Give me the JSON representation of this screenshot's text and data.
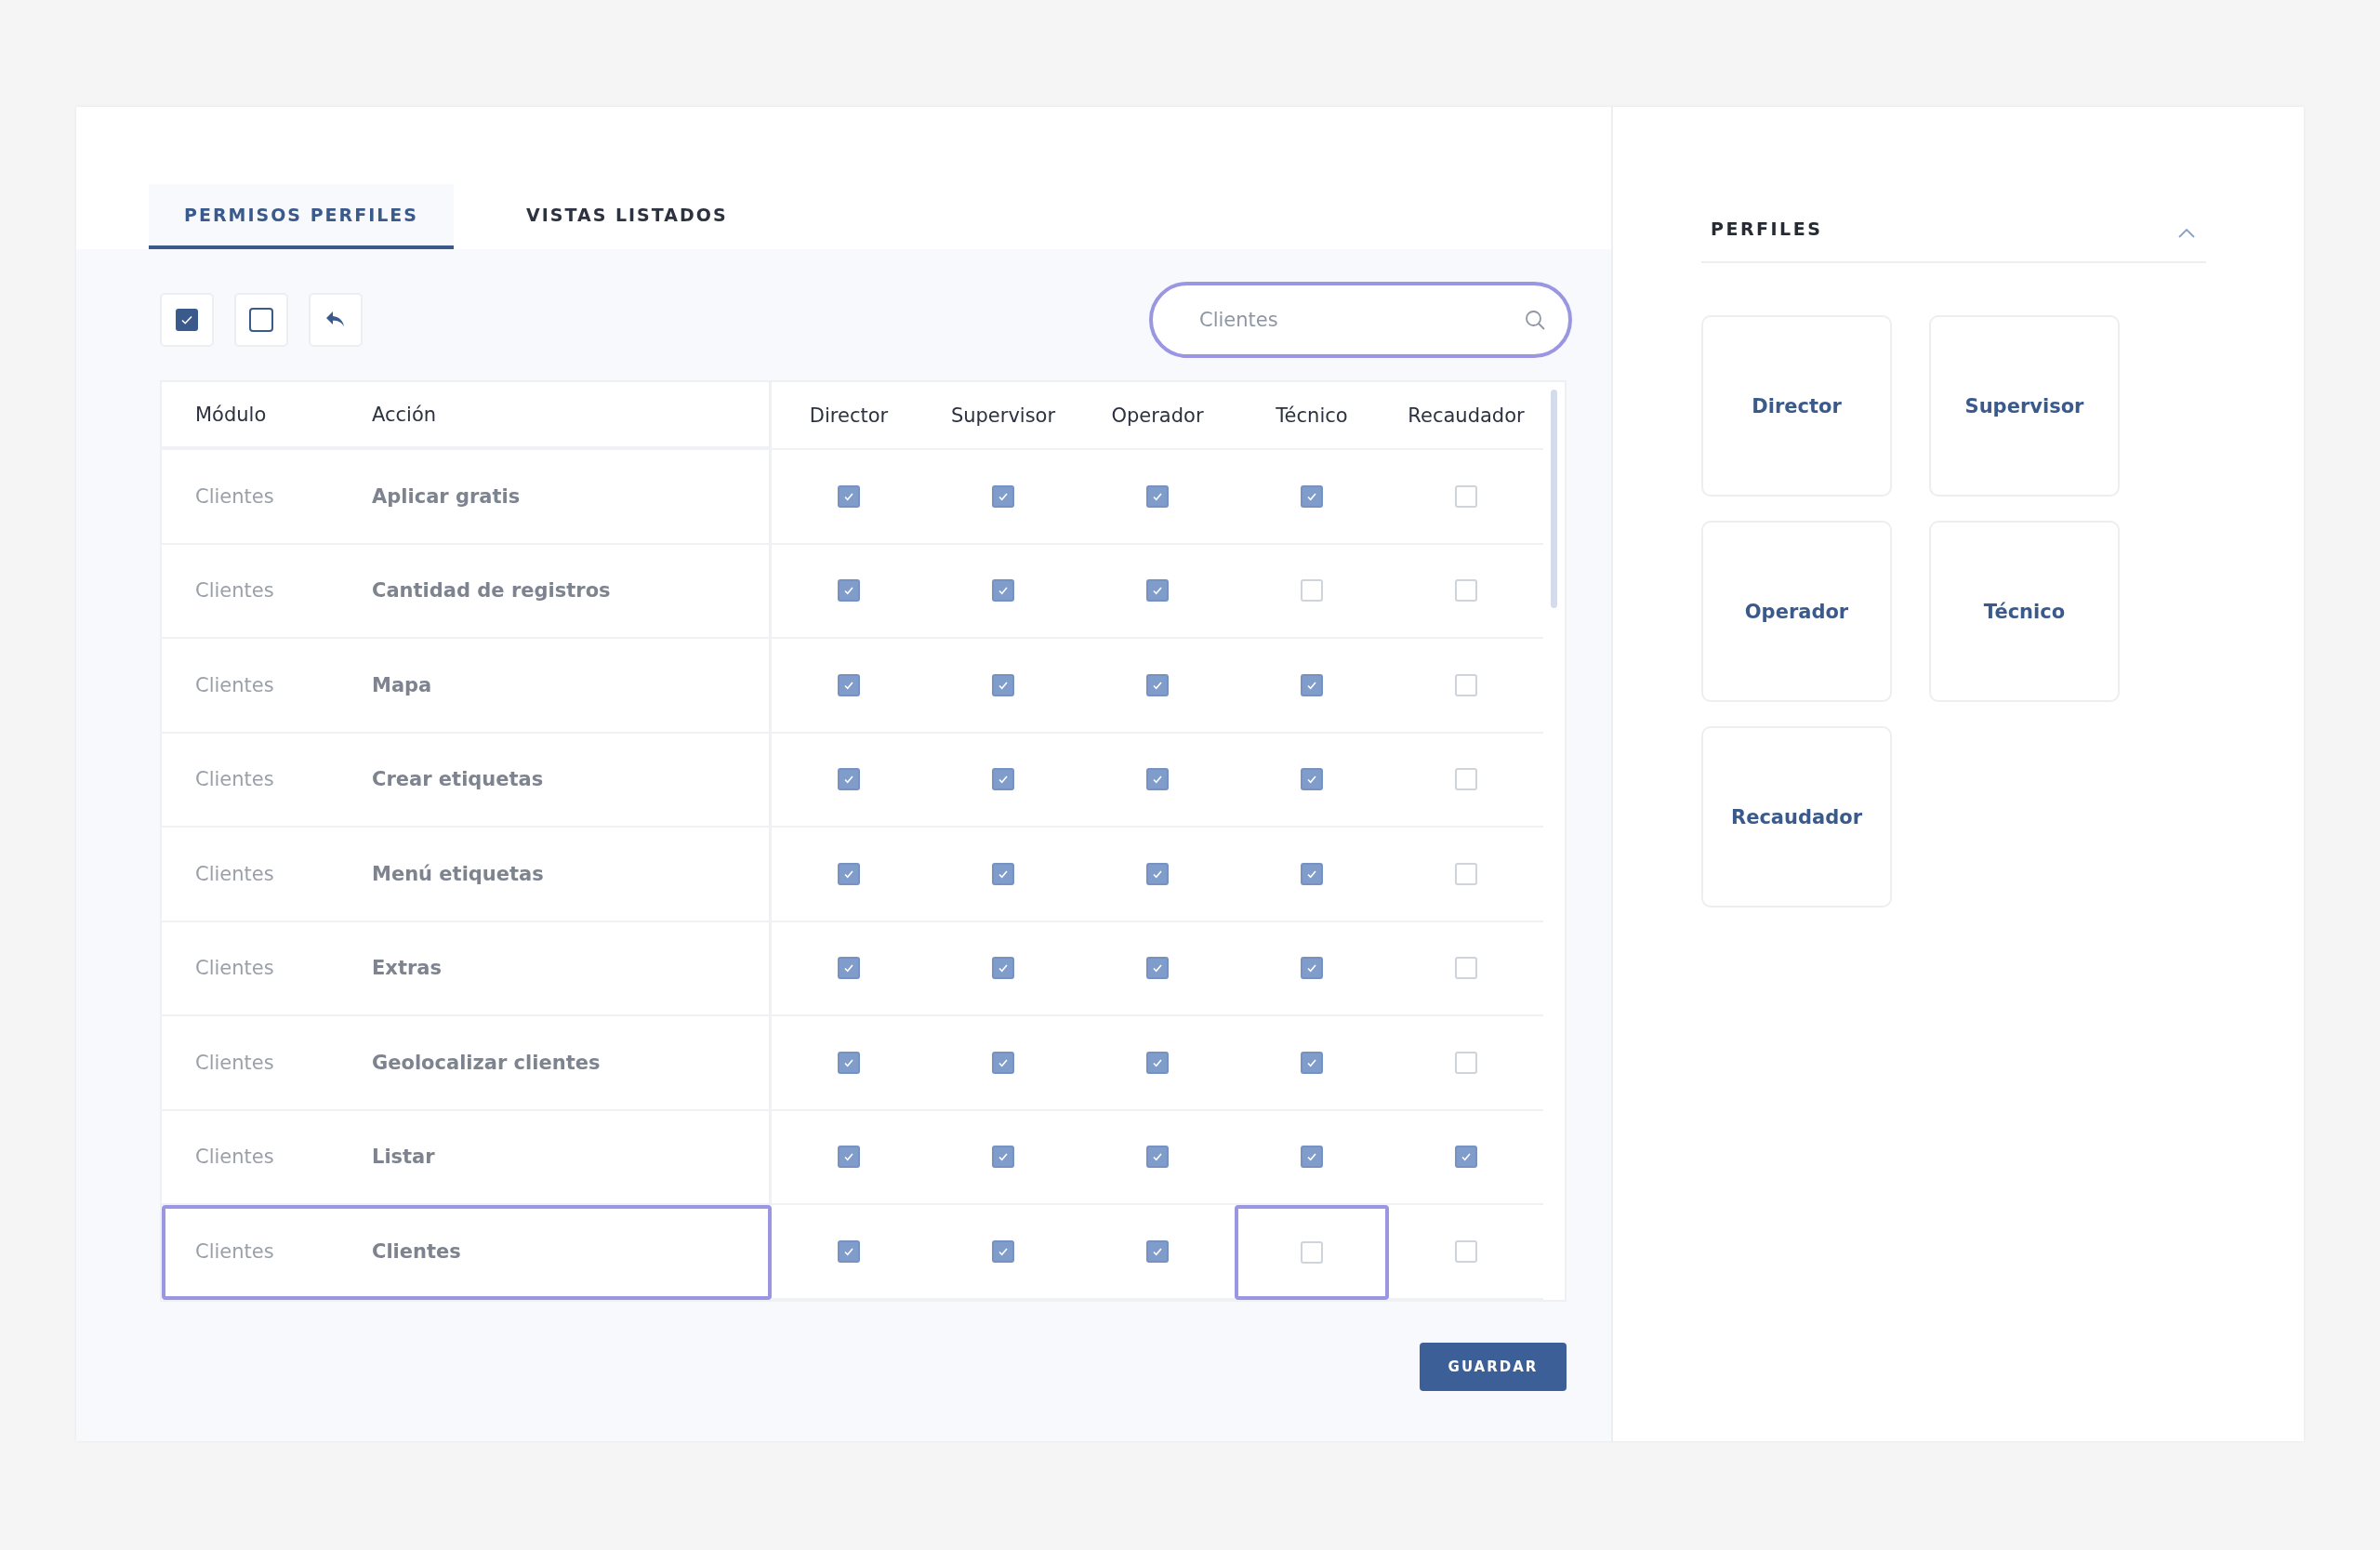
{
  "tabs": [
    {
      "label": "PERMISOS PERFILES",
      "selected": true
    },
    {
      "label": "VISTAS LISTADOS",
      "selected": false
    }
  ],
  "search": {
    "placeholder": "Clientes",
    "focused": true
  },
  "table": {
    "columns": [
      "Módulo",
      "Acción",
      "Director",
      "Supervisor",
      "Operador",
      "Técnico",
      "Recaudador"
    ],
    "rows": [
      {
        "module": "Clientes",
        "action": "Aplicar gratis",
        "highlighted": false,
        "checks": [
          {
            "checked": true,
            "highlighted": false
          },
          {
            "checked": true,
            "highlighted": false
          },
          {
            "checked": true,
            "highlighted": false
          },
          {
            "checked": true,
            "highlighted": false
          },
          {
            "checked": false,
            "highlighted": false
          }
        ]
      },
      {
        "module": "Clientes",
        "action": "Cantidad de registros",
        "highlighted": false,
        "checks": [
          {
            "checked": true,
            "highlighted": false
          },
          {
            "checked": true,
            "highlighted": false
          },
          {
            "checked": true,
            "highlighted": false
          },
          {
            "checked": false,
            "highlighted": false
          },
          {
            "checked": false,
            "highlighted": false
          }
        ]
      },
      {
        "module": "Clientes",
        "action": "Mapa",
        "highlighted": false,
        "checks": [
          {
            "checked": true,
            "highlighted": false
          },
          {
            "checked": true,
            "highlighted": false
          },
          {
            "checked": true,
            "highlighted": false
          },
          {
            "checked": true,
            "highlighted": false
          },
          {
            "checked": false,
            "highlighted": false
          }
        ]
      },
      {
        "module": "Clientes",
        "action": "Crear etiquetas",
        "highlighted": false,
        "checks": [
          {
            "checked": true,
            "highlighted": false
          },
          {
            "checked": true,
            "highlighted": false
          },
          {
            "checked": true,
            "highlighted": false
          },
          {
            "checked": true,
            "highlighted": false
          },
          {
            "checked": false,
            "highlighted": false
          }
        ]
      },
      {
        "module": "Clientes",
        "action": "Menú etiquetas",
        "highlighted": false,
        "checks": [
          {
            "checked": true,
            "highlighted": false
          },
          {
            "checked": true,
            "highlighted": false
          },
          {
            "checked": true,
            "highlighted": false
          },
          {
            "checked": true,
            "highlighted": false
          },
          {
            "checked": false,
            "highlighted": false
          }
        ]
      },
      {
        "module": "Clientes",
        "action": "Extras",
        "highlighted": false,
        "checks": [
          {
            "checked": true,
            "highlighted": false
          },
          {
            "checked": true,
            "highlighted": false
          },
          {
            "checked": true,
            "highlighted": false
          },
          {
            "checked": true,
            "highlighted": false
          },
          {
            "checked": false,
            "highlighted": false
          }
        ]
      },
      {
        "module": "Clientes",
        "action": "Geolocalizar clientes",
        "highlighted": false,
        "checks": [
          {
            "checked": true,
            "highlighted": false
          },
          {
            "checked": true,
            "highlighted": false
          },
          {
            "checked": true,
            "highlighted": false
          },
          {
            "checked": true,
            "highlighted": false
          },
          {
            "checked": false,
            "highlighted": false
          }
        ]
      },
      {
        "module": "Clientes",
        "action": "Listar",
        "highlighted": false,
        "checks": [
          {
            "checked": true,
            "highlighted": false
          },
          {
            "checked": true,
            "highlighted": false
          },
          {
            "checked": true,
            "highlighted": false
          },
          {
            "checked": true,
            "highlighted": false
          },
          {
            "checked": true,
            "highlighted": false
          }
        ]
      },
      {
        "module": "Clientes",
        "action": "Clientes",
        "highlighted": true,
        "checks": [
          {
            "checked": true,
            "highlighted": false
          },
          {
            "checked": true,
            "highlighted": false
          },
          {
            "checked": true,
            "highlighted": false
          },
          {
            "checked": false,
            "highlighted": true
          },
          {
            "checked": false,
            "highlighted": false
          }
        ]
      }
    ]
  },
  "save_button": "GUARDAR",
  "profiles": {
    "title": "PERFILES",
    "expanded": true,
    "items": [
      "Director",
      "Supervisor",
      "Operador",
      "Técnico",
      "Recaudador"
    ]
  }
}
